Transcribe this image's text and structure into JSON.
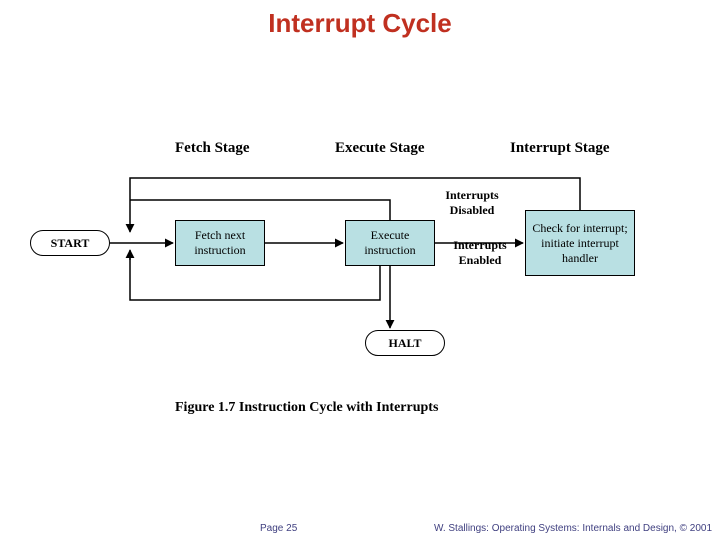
{
  "title": "Interrupt Cycle",
  "stages": {
    "fetch": "Fetch Stage",
    "execute": "Execute Stage",
    "interrupt": "Interrupt Stage"
  },
  "nodes": {
    "start": "START",
    "fetch_next": "Fetch next instruction",
    "execute_instr": "Execute instruction",
    "check_interrupt": "Check for interrupt; initiate interrupt handler",
    "halt": "HALT"
  },
  "edge_labels": {
    "interrupts_disabled": "Interrupts Disabled",
    "interrupts_enabled": "Interrupts Enabled"
  },
  "caption": "Figure 1.7   Instruction Cycle with Interrupts",
  "footer": {
    "page": "Page 25",
    "citation": "W. Stallings: Operating Systems: Internals and Design, © 2001"
  }
}
